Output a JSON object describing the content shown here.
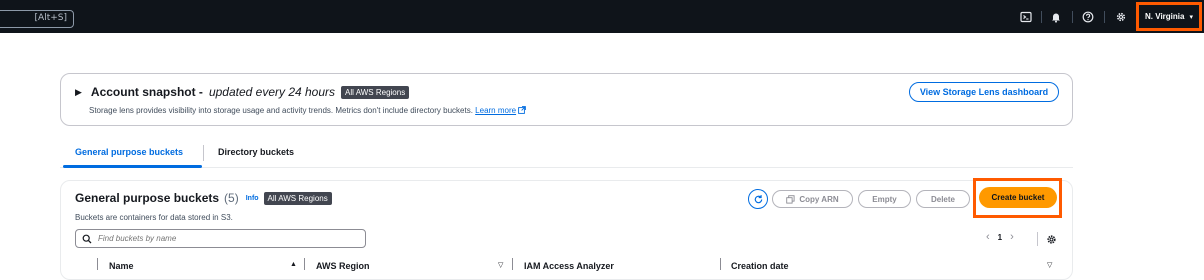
{
  "topnav": {
    "search_shortcut": "[Alt+S]",
    "icons": [
      "cloudshell-icon",
      "bell-icon",
      "help-icon",
      "gear-icon"
    ],
    "region_label": "N. Virginia",
    "region_caret": "▾",
    "highlight_color": "#ff5a00"
  },
  "snapshot": {
    "title": "Account snapshot -",
    "subtitle": "updated every 24 hours",
    "badge": "All AWS Regions",
    "description": "Storage lens provides visibility into storage usage and activity trends. Metrics don't include directory buckets.",
    "learn_more": "Learn more",
    "dashboard_button": "View Storage Lens dashboard"
  },
  "tabs": [
    {
      "label": "General purpose buckets",
      "active": true
    },
    {
      "label": "Directory buckets",
      "active": false
    }
  ],
  "buckets": {
    "title": "General purpose buckets",
    "count": "(5)",
    "info": "Info",
    "badge": "All AWS Regions",
    "description": "Buckets are containers for data stored in S3.",
    "buttons": {
      "copy_arn": "Copy ARN",
      "empty": "Empty",
      "delete": "Delete",
      "create": "Create bucket"
    },
    "search_placeholder": "Find buckets by name",
    "page": "1",
    "columns": [
      "Name",
      "AWS Region",
      "IAM Access Analyzer",
      "Creation date"
    ]
  },
  "colors": {
    "accent": "#006ce0",
    "primary_button": "#ff9900",
    "nav_bg": "#0f141a"
  }
}
